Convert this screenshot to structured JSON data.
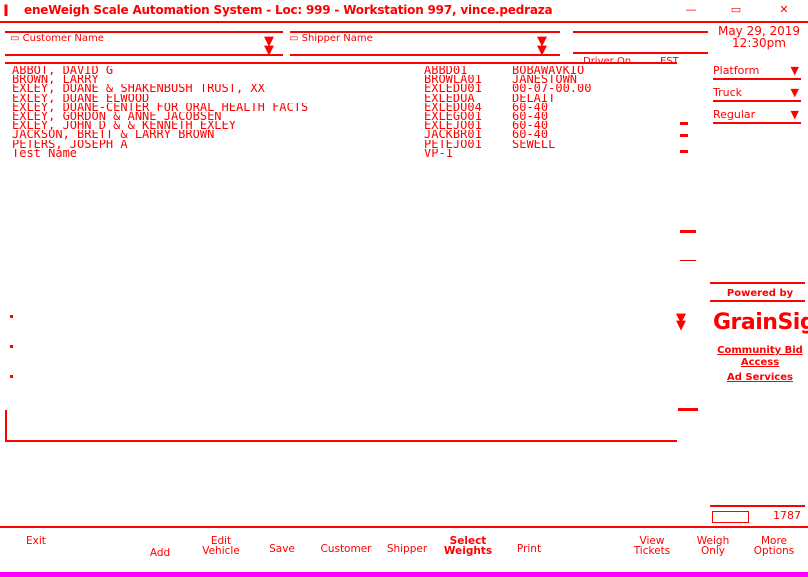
{
  "window": {
    "title": "eneWeigh Scale Automation System - Loc: 999 - Workstation 997, vince.pedraza",
    "minimize_glyph": "—",
    "restore_glyph": "▭",
    "close_glyph": "✕"
  },
  "filters": {
    "customer_label": "Customer Name",
    "shipper_label": "Shipper Name",
    "driver_on_label": "Driver On",
    "extra_label": "EST"
  },
  "list": {
    "rows": [
      {
        "name": "ABBOT, DAVID G",
        "id": "ABBD01",
        "code": "BOBAWAVKIO"
      },
      {
        "name": "BROWN, LARRY",
        "id": "BROWLA01",
        "code": "JANESTOWN"
      },
      {
        "name": "EXLEY, DUANE & SHAKENBUSH TRUST, XX",
        "id": "EXLEDU01",
        "code": "00-07-00.00"
      },
      {
        "name": "EXLEY, DUANE ELWOOD",
        "id": "EXLEDUA",
        "code": "DELAIT"
      },
      {
        "name": "EXLEY, DUANE-CENTER FOR ORAL HEALTH FACTS",
        "id": "EXLEDU04",
        "code": "60-40"
      },
      {
        "name": "EXLEY, GORDON & ANNE JACOBSEN",
        "id": "EXLEGO01",
        "code": "60-40"
      },
      {
        "name": "EXLEY, JOHN D & & KENNETH EXLEY",
        "id": "EXLEJO01",
        "code": "60-40"
      },
      {
        "name": "JACKSON, BRETT & LARRY BROWN",
        "id": "JACKBR01",
        "code": "60-40"
      },
      {
        "name": "PETERS, JOSEPH A",
        "id": "PETEJO01",
        "code": "SEWELL"
      },
      {
        "name": "Test Name",
        "id": "VP-1",
        "code": ""
      }
    ]
  },
  "side": {
    "date": "May 29, 2019",
    "time": "12:30pm",
    "platform_label": "Platform",
    "truck_label": "Truck",
    "regular_label": "Regular",
    "dd_glyph": "▼",
    "brand_top": "Powered by",
    "logo_text": "GrainSight",
    "community_label": "Community Bid",
    "access_label": "Access",
    "ad_label": "Ad Services"
  },
  "status": {
    "ind": "1787"
  },
  "fkeys": [
    {
      "line1": "Exit",
      "line2": ""
    },
    {
      "line1": "Add",
      "line2": ""
    },
    {
      "line1": "Edit",
      "line2": "Vehicle"
    },
    {
      "line1": "Save",
      "line2": ""
    },
    {
      "line1": "Customer",
      "line2": ""
    },
    {
      "line1": "Shipper",
      "line2": ""
    },
    {
      "line1": "Select",
      "line2": "Weights"
    },
    {
      "line1": "Print",
      "line2": ""
    },
    {
      "line1": "View",
      "line2": "Tickets"
    },
    {
      "line1": "Weigh",
      "line2": "Only"
    },
    {
      "line1": "More",
      "line2": "Options"
    }
  ],
  "colors": {
    "accent": "#ff0000",
    "background": "#ffffff"
  }
}
